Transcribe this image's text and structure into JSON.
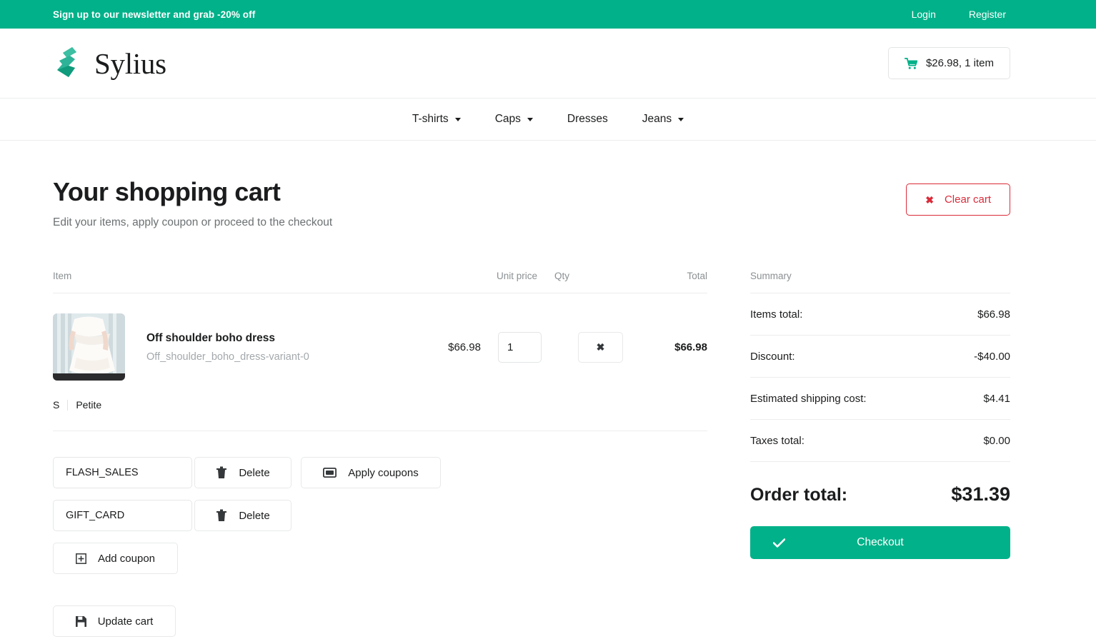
{
  "topbar": {
    "message": "Sign up to our newsletter and grab -20% off",
    "login": "Login",
    "register": "Register"
  },
  "header": {
    "brand_name": "Sylius",
    "brand_logo_icon": "sylius-swan-logo",
    "cart_icon": "shopping-cart-icon",
    "cart_summary": "$26.98, 1 item"
  },
  "nav": {
    "items": [
      {
        "label": "T-shirts",
        "has_dropdown": true
      },
      {
        "label": "Caps",
        "has_dropdown": true
      },
      {
        "label": "Dresses",
        "has_dropdown": false
      },
      {
        "label": "Jeans",
        "has_dropdown": true
      }
    ]
  },
  "page": {
    "title": "Your shopping cart",
    "subtitle": "Edit your items, apply coupon or proceed to the checkout",
    "clear_cart_label": "Clear cart",
    "clear_cart_icon": "close-x-icon",
    "clear_cart_color": "#db2b39"
  },
  "cart": {
    "headers": {
      "item": "Item",
      "unit_price": "Unit price",
      "qty": "Qty",
      "total": "Total"
    },
    "rows": [
      {
        "name": "Off shoulder boho dress",
        "variant": "Off_shoulder_boho_dress-variant-0",
        "unit_price": "$66.98",
        "qty": "1",
        "total": "$66.98",
        "remove_icon": "close-x-icon",
        "options": [
          "S",
          "Petite"
        ],
        "thumbnail_icon": "product-thumbnail-white-dress"
      }
    ]
  },
  "coupons": {
    "entries": [
      {
        "code": "FLASH_SALES",
        "delete_label": "Delete",
        "delete_icon": "trash-icon"
      },
      {
        "code": "GIFT_CARD",
        "delete_label": "Delete",
        "delete_icon": "trash-icon"
      }
    ],
    "apply_label": "Apply coupons",
    "apply_icon": "ticket-icon",
    "add_label": "Add coupon",
    "add_icon": "plus-square-icon",
    "update_label": "Update cart",
    "update_icon": "save-floppy-icon"
  },
  "summary": {
    "title": "Summary",
    "rows": [
      {
        "label": "Items total:",
        "value": "$66.98"
      },
      {
        "label": "Discount:",
        "value": "-$40.00"
      },
      {
        "label": "Estimated shipping cost:",
        "value": "$4.41"
      },
      {
        "label": "Taxes total:",
        "value": "$0.00"
      }
    ],
    "order_total_label": "Order total:",
    "order_total_value": "$31.39",
    "checkout_label": "Checkout",
    "checkout_icon": "check-icon",
    "accent_color": "#00b189"
  }
}
